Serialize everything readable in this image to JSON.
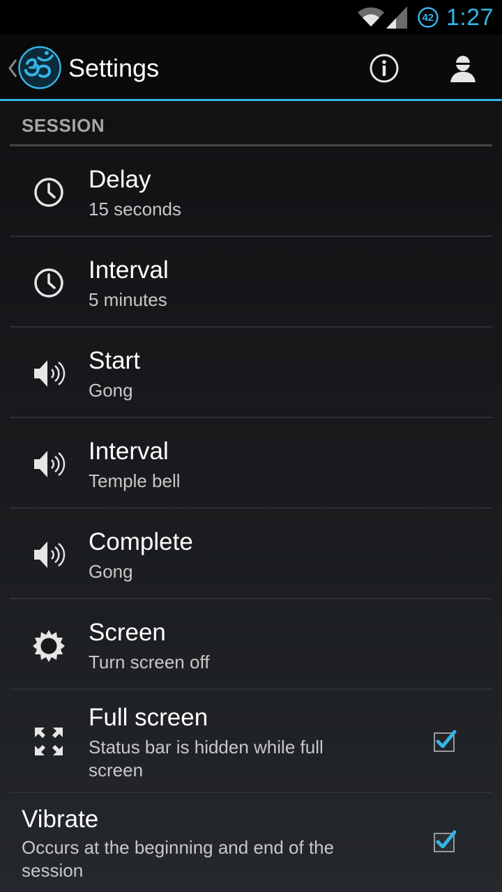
{
  "status_bar": {
    "time": "1:27",
    "battery_level": "42",
    "icons": [
      "wifi-icon",
      "cell-signal-icon",
      "battery-icon"
    ]
  },
  "action_bar": {
    "title": "Settings",
    "icons": [
      "up-caret-icon",
      "om-logo-icon",
      "info-icon",
      "profile-icon"
    ]
  },
  "section": {
    "header": "SESSION"
  },
  "prefs": [
    {
      "title": "Delay",
      "summary": "15 seconds",
      "icon": "clock-icon"
    },
    {
      "title": "Interval",
      "summary": "5 minutes",
      "icon": "clock-icon"
    },
    {
      "title": "Start",
      "summary": "Gong",
      "icon": "speaker-icon"
    },
    {
      "title": "Interval",
      "summary": "Temple bell",
      "icon": "speaker-icon"
    },
    {
      "title": "Complete",
      "summary": "Gong",
      "icon": "speaker-icon"
    },
    {
      "title": "Screen",
      "summary": "Turn screen off",
      "icon": "brightness-icon"
    },
    {
      "title": "Full screen",
      "summary": "Status bar is hidden while full screen",
      "icon": "fullscreen-icon",
      "checked": true
    }
  ],
  "vibrate": {
    "title": "Vibrate",
    "summary": "Occurs at the beginning and end of the session",
    "checked": true
  },
  "colors": {
    "accent": "#33b5e5",
    "background_top": "#111214",
    "background_bottom": "#25282c",
    "divider": "#2e3033"
  }
}
